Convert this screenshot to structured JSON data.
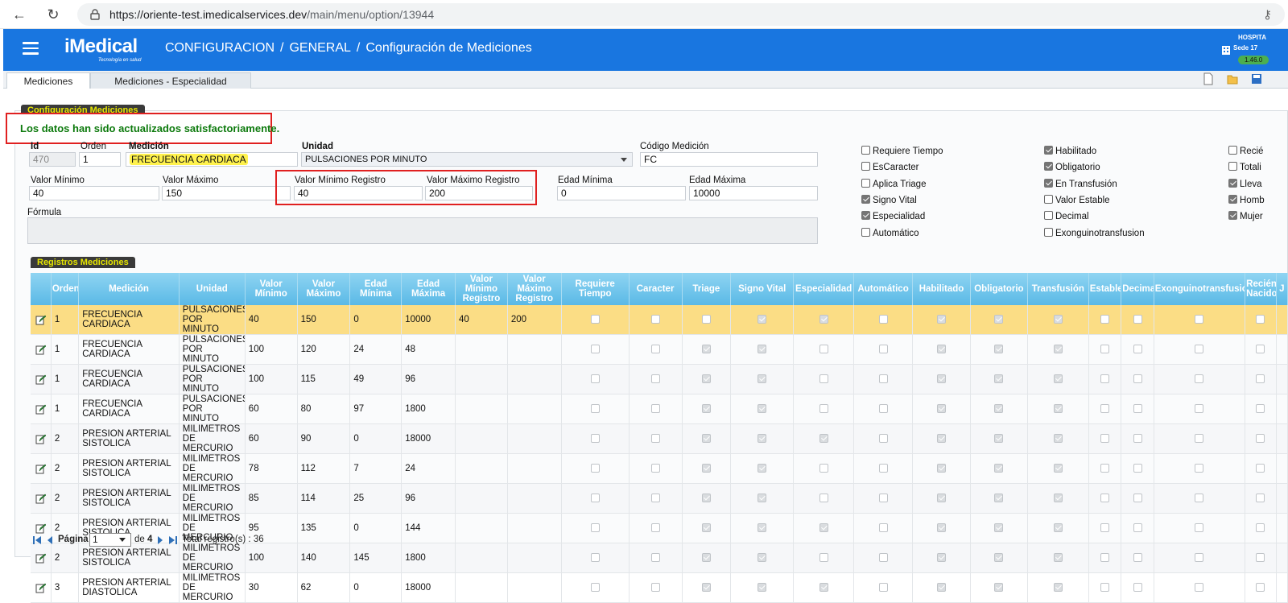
{
  "browser": {
    "url_host": "https://oriente-test.imedicalservices.dev",
    "url_path": "/main/menu/option/13944"
  },
  "header": {
    "logo_text": "iMedical",
    "logo_tagline": "Tecnología en salud",
    "breadcrumb": [
      "CONFIGURACION",
      "GENERAL",
      "Configuración de Mediciones"
    ],
    "separator": "/",
    "hospital": "HOSPITA",
    "sede": "Sede 17",
    "version": "1.46.0"
  },
  "tabs": [
    {
      "label": "Mediciones",
      "active": true
    },
    {
      "label": "Mediciones - Especialidad",
      "active": false
    }
  ],
  "config_section": {
    "label": "Configuración Mediciones",
    "message": "Los datos han sido actualizados satisfactoriamente."
  },
  "form": {
    "id_label": "Id",
    "id_value": "470",
    "orden_label": "Orden",
    "orden_value": "1",
    "medicion_label": "Medición",
    "medicion_value": "FRECUENCIA CARDIACA",
    "unidad_label": "Unidad",
    "unidad_value": "PULSACIONES POR MINUTO",
    "codigo_label": "Código Medición",
    "codigo_value": "FC",
    "valor_min_label": "Valor Mínimo",
    "valor_min_value": "40",
    "valor_max_label": "Valor Máximo",
    "valor_max_value": "150",
    "valor_min_reg_label": "Valor Mínimo Registro",
    "valor_min_reg_value": "40",
    "valor_max_reg_label": "Valor Máximo Registro",
    "valor_max_reg_value": "200",
    "edad_min_label": "Edad Mínima",
    "edad_min_value": "0",
    "edad_max_label": "Edad Máxima",
    "edad_max_value": "10000",
    "formula_label": "Fórmula"
  },
  "checkboxes": {
    "col1": [
      {
        "label": "Requiere Tiempo",
        "checked": false
      },
      {
        "label": "EsCaracter",
        "checked": false
      },
      {
        "label": "Aplica Triage",
        "checked": false
      },
      {
        "label": "Signo Vital",
        "checked": true
      },
      {
        "label": "Especialidad",
        "checked": true
      },
      {
        "label": "Automático",
        "checked": false
      }
    ],
    "col2": [
      {
        "label": "Habilitado",
        "checked": true
      },
      {
        "label": "Obligatorio",
        "checked": true
      },
      {
        "label": "En Transfusión",
        "checked": true
      },
      {
        "label": "Valor Estable",
        "checked": false
      },
      {
        "label": "Decimal",
        "checked": false
      },
      {
        "label": "Exonguinotransfusion",
        "checked": false
      }
    ],
    "col3": [
      {
        "label": "Recié",
        "checked": false
      },
      {
        "label": "Totali",
        "checked": false
      },
      {
        "label": "Lleva",
        "checked": true
      },
      {
        "label": "Homb",
        "checked": true
      },
      {
        "label": "Mujer",
        "checked": true
      }
    ]
  },
  "grid_section": {
    "label": "Registros Mediciones",
    "columns": [
      "",
      "Orden",
      "Medición",
      "Unidad",
      "Valor Mínimo",
      "Valor Máximo",
      "Edad Mínima",
      "Edad Máxima",
      "Valor Mínimo Registro",
      "Valor Máximo Registro",
      "Requiere Tiempo",
      "Caracter",
      "Triage",
      "Signo Vital",
      "Especialidad",
      "Automático",
      "Habilitado",
      "Obligatorio",
      "Transfusión",
      "Estable",
      "Decimal",
      "Exonguinotransfusion",
      "Recién Nacido",
      "J"
    ],
    "rows": [
      {
        "orden": "1",
        "medicion": "FRECUENCIA CARDIACA",
        "unidad": "PULSACIONES POR MINUTO",
        "vmin": "40",
        "vmax": "150",
        "emin": "0",
        "emax": "10000",
        "vminr": "40",
        "vmaxr": "200",
        "checks": [
          0,
          0,
          0,
          1,
          1,
          0,
          1,
          1,
          1,
          0,
          0,
          0,
          0
        ],
        "selected": true
      },
      {
        "orden": "1",
        "medicion": "FRECUENCIA CARDIACA",
        "unidad": "PULSACIONES POR MINUTO",
        "vmin": "100",
        "vmax": "120",
        "emin": "24",
        "emax": "48",
        "vminr": "",
        "vmaxr": "",
        "checks": [
          0,
          0,
          1,
          1,
          0,
          0,
          1,
          1,
          1,
          0,
          0,
          0,
          0
        ]
      },
      {
        "orden": "1",
        "medicion": "FRECUENCIA CARDIACA",
        "unidad": "PULSACIONES POR MINUTO",
        "vmin": "100",
        "vmax": "115",
        "emin": "49",
        "emax": "96",
        "vminr": "",
        "vmaxr": "",
        "checks": [
          0,
          0,
          1,
          1,
          0,
          0,
          1,
          1,
          1,
          0,
          0,
          0,
          0
        ]
      },
      {
        "orden": "1",
        "medicion": "FRECUENCIA CARDIACA",
        "unidad": "PULSACIONES POR MINUTO",
        "vmin": "60",
        "vmax": "80",
        "emin": "97",
        "emax": "1800",
        "vminr": "",
        "vmaxr": "",
        "checks": [
          0,
          0,
          1,
          1,
          0,
          0,
          1,
          1,
          1,
          0,
          0,
          0,
          0
        ]
      },
      {
        "orden": "2",
        "medicion": "PRESION ARTERIAL SISTOLICA",
        "unidad": "MILIMETROS DE MERCURIO",
        "vmin": "60",
        "vmax": "90",
        "emin": "0",
        "emax": "18000",
        "vminr": "",
        "vmaxr": "",
        "checks": [
          0,
          0,
          1,
          1,
          1,
          0,
          1,
          1,
          1,
          0,
          0,
          0,
          0
        ]
      },
      {
        "orden": "2",
        "medicion": "PRESION ARTERIAL SISTOLICA",
        "unidad": "MILIMETROS DE MERCURIO",
        "vmin": "78",
        "vmax": "112",
        "emin": "7",
        "emax": "24",
        "vminr": "",
        "vmaxr": "",
        "checks": [
          0,
          0,
          1,
          1,
          0,
          0,
          1,
          1,
          1,
          0,
          0,
          0,
          0
        ]
      },
      {
        "orden": "2",
        "medicion": "PRESION ARTERIAL SISTOLICA",
        "unidad": "MILIMETROS DE MERCURIO",
        "vmin": "85",
        "vmax": "114",
        "emin": "25",
        "emax": "96",
        "vminr": "",
        "vmaxr": "",
        "checks": [
          0,
          0,
          1,
          1,
          0,
          0,
          1,
          1,
          1,
          0,
          0,
          0,
          0
        ]
      },
      {
        "orden": "2",
        "medicion": "PRESION ARTERIAL SISTOLICA",
        "unidad": "MILIMETROS DE MERCURIO",
        "vmin": "95",
        "vmax": "135",
        "emin": "0",
        "emax": "144",
        "vminr": "",
        "vmaxr": "",
        "checks": [
          0,
          0,
          1,
          1,
          1,
          0,
          1,
          1,
          1,
          0,
          0,
          0,
          0
        ]
      },
      {
        "orden": "2",
        "medicion": "PRESION ARTERIAL SISTOLICA",
        "unidad": "MILIMETROS DE MERCURIO",
        "vmin": "100",
        "vmax": "140",
        "emin": "145",
        "emax": "1800",
        "vminr": "",
        "vmaxr": "",
        "checks": [
          0,
          0,
          1,
          1,
          0,
          0,
          1,
          1,
          1,
          0,
          0,
          0,
          0
        ]
      },
      {
        "orden": "3",
        "medicion": "PRESION ARTERIAL DIASTOLICA",
        "unidad": "MILIMETROS DE MERCURIO",
        "vmin": "30",
        "vmax": "62",
        "emin": "0",
        "emax": "18000",
        "vminr": "",
        "vmaxr": "",
        "checks": [
          0,
          0,
          1,
          1,
          1,
          0,
          1,
          1,
          1,
          0,
          0,
          0,
          0
        ]
      }
    ]
  },
  "pager": {
    "page_label": "Página",
    "page_value": "1",
    "of_label": "de",
    "total_pages": "4",
    "total_label": "Total registro(s) : 36"
  }
}
